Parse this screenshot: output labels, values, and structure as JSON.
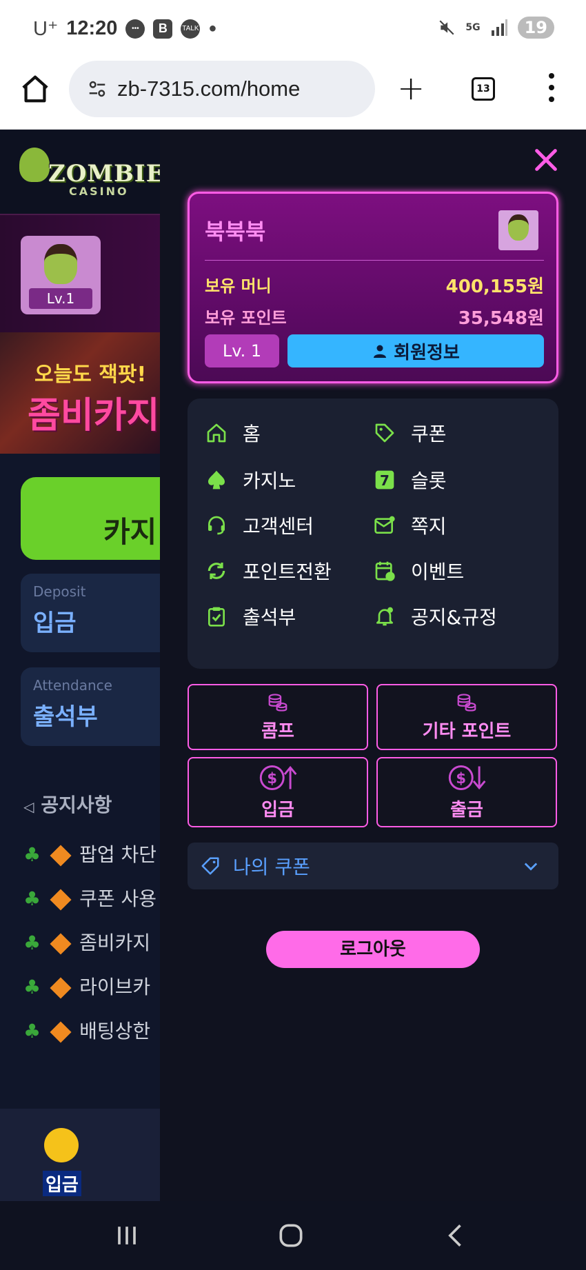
{
  "status": {
    "carrier": "U⁺",
    "time": "12:20",
    "battery": "19"
  },
  "browser": {
    "url": "zb-7315.com/home",
    "tab_count": "13"
  },
  "bg": {
    "logo_title": "ZOMBIE",
    "logo_sub": "CASINO",
    "profile_level": "Lv.1",
    "banner_line1": "오늘도 잭팟!",
    "banner_line2": "좀비카지",
    "casino_button": "카지",
    "deposit_en": "Deposit",
    "deposit_ko": "입금",
    "attendance_en": "Attendance",
    "attendance_ko": "출석부",
    "notice_title": "공지사항",
    "notices": [
      "팝업 차단",
      "쿠폰 사용",
      "좀비카지",
      "라이브카",
      "배팅상한"
    ],
    "bottom_label": "입금"
  },
  "profile": {
    "name": "북북북",
    "money_label": "보유 머니",
    "money_value": "400,155원",
    "point_label": "보유 포인트",
    "point_value": "35,548원",
    "level": "Lv. 1",
    "info_button": "회원정보"
  },
  "menu": [
    "홈",
    "쿠폰",
    "카지노",
    "슬롯",
    "고객센터",
    "쪽지",
    "포인트전환",
    "이벤트",
    "출석부",
    "공지&규정"
  ],
  "buttons": {
    "comp": "콤프",
    "other_points": "기타 포인트",
    "deposit": "입금",
    "withdraw": "출금"
  },
  "coupon": {
    "label": "나의 쿠폰"
  },
  "logout": "로그아웃",
  "colors": {
    "accent": "#ff5ce6",
    "menu_icon": "#7be04a",
    "info_button": "#35b5ff",
    "gold": "#ffe36a"
  }
}
